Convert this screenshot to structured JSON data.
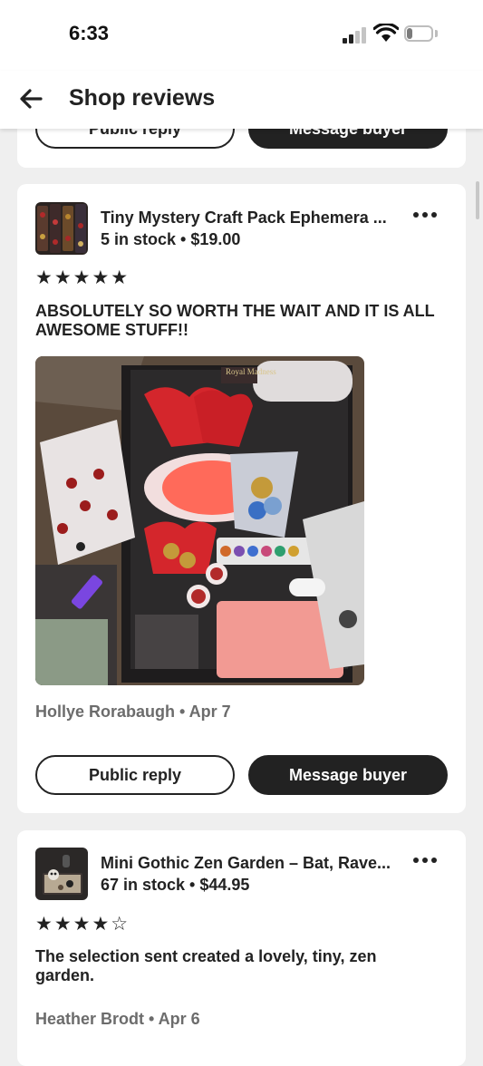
{
  "status_bar": {
    "time": "6:33",
    "battery": "21",
    "battery_level": 0.21
  },
  "nav": {
    "title": "Shop reviews",
    "back_icon": "arrow-left-icon"
  },
  "buttons": {
    "public_reply": "Public reply",
    "message_buyer": "Message buyer"
  },
  "reviews": [
    {
      "item_title": "Tiny Mystery Craft Pack Ephemera ...",
      "item_meta": "5 in stock • $19.00",
      "rating": 5,
      "stars": "★★★★★",
      "text": "ABSOLUTELY SO WORTH THE WAIT AND IT IS ALL AWESOME STUFF!!",
      "reviewer": "Hollye Rorabaugh • Apr 7",
      "photo_caption": "Royal Madness"
    },
    {
      "item_title": "Mini Gothic Zen Garden – Bat, Rave...",
      "item_meta": "67 in stock • $44.95",
      "rating": 4,
      "stars": "★★★★☆",
      "text": "The selection sent created a lovely, tiny, zen garden.",
      "reviewer": "Heather Brodt • Apr 6"
    }
  ]
}
